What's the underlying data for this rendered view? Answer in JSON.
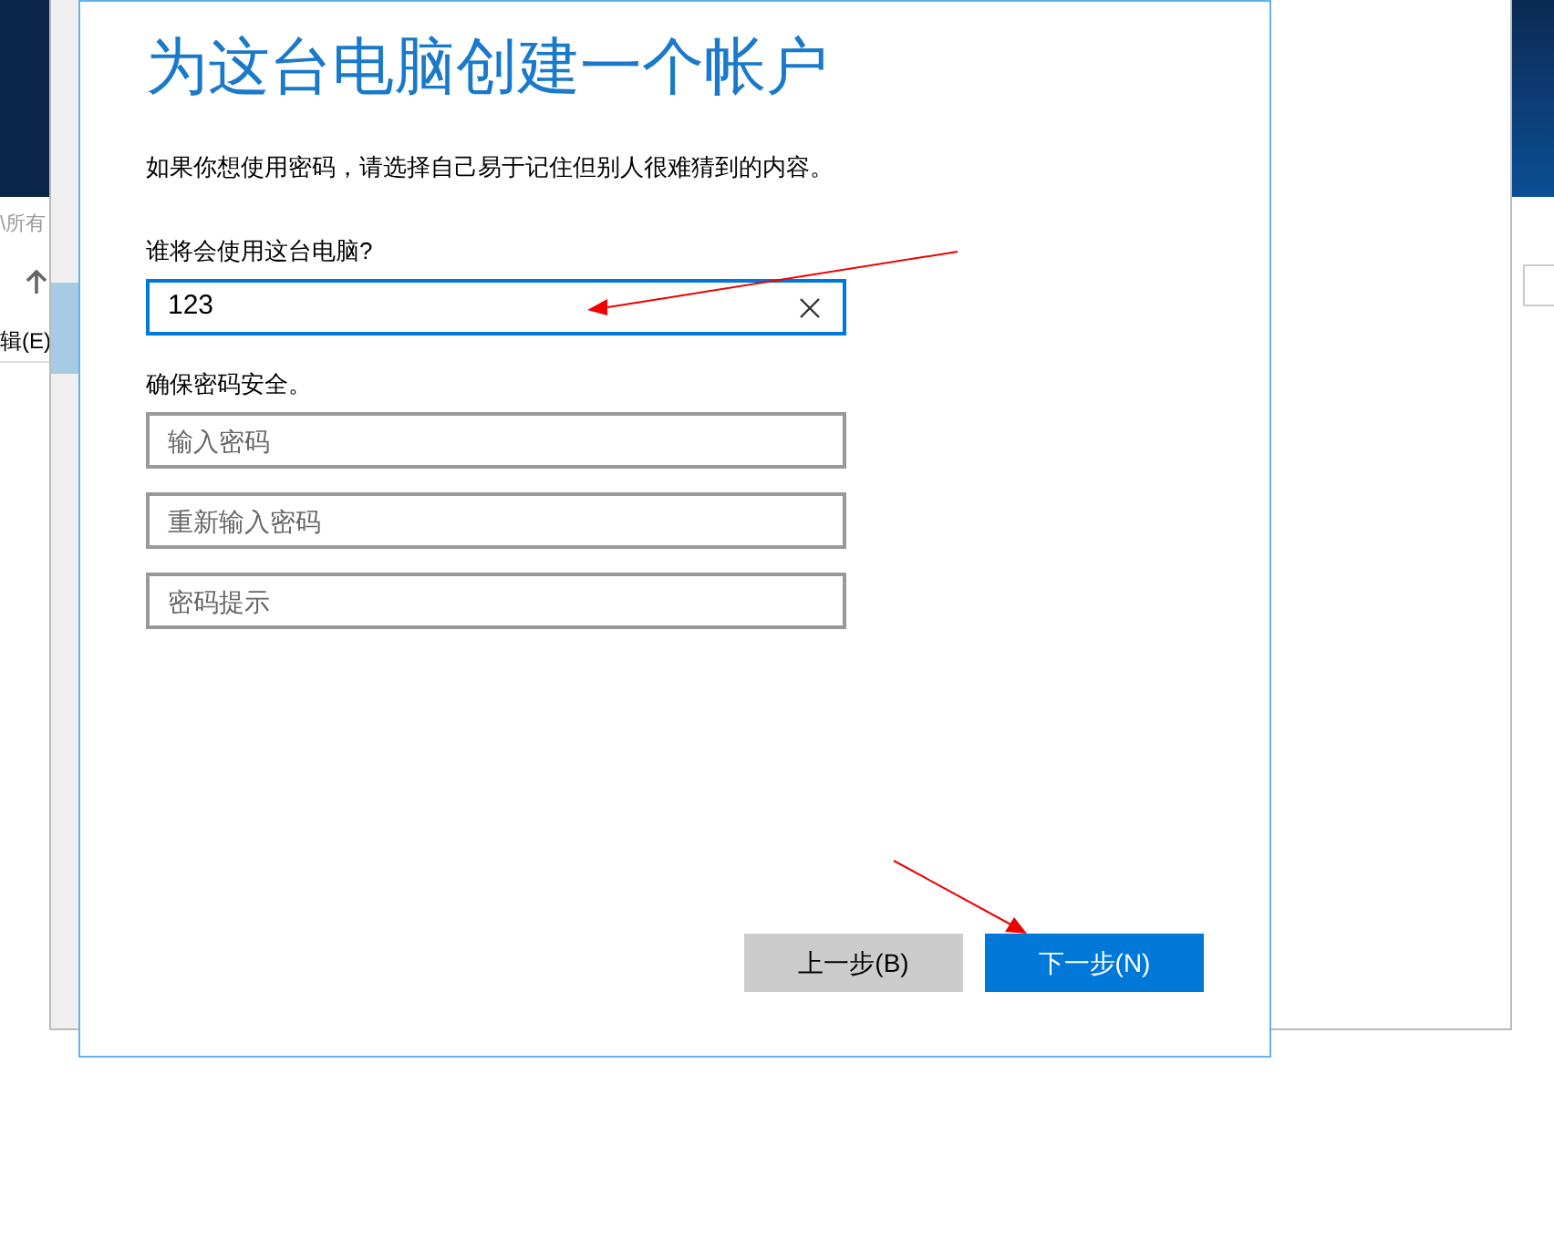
{
  "background_window": {
    "path_fragment": "\\所有",
    "menu_fragment": "辑(E)"
  },
  "dialog": {
    "title": "为这台电脑创建一个帐户",
    "intro": "如果你想使用密码，请选择自己易于记住但别人很难猜到的内容。",
    "user_label": "谁将会使用这台电脑?",
    "user_field": {
      "value": "123",
      "focused": true
    },
    "password_label": "确保密码安全。",
    "password_fields": [
      {
        "placeholder": "输入密码"
      },
      {
        "placeholder": "重新输入密码"
      },
      {
        "placeholder": "密码提示"
      }
    ],
    "buttons": [
      {
        "label": "上一步(B)",
        "kind": "secondary"
      },
      {
        "label": "下一步(N)",
        "kind": "primary"
      }
    ]
  }
}
